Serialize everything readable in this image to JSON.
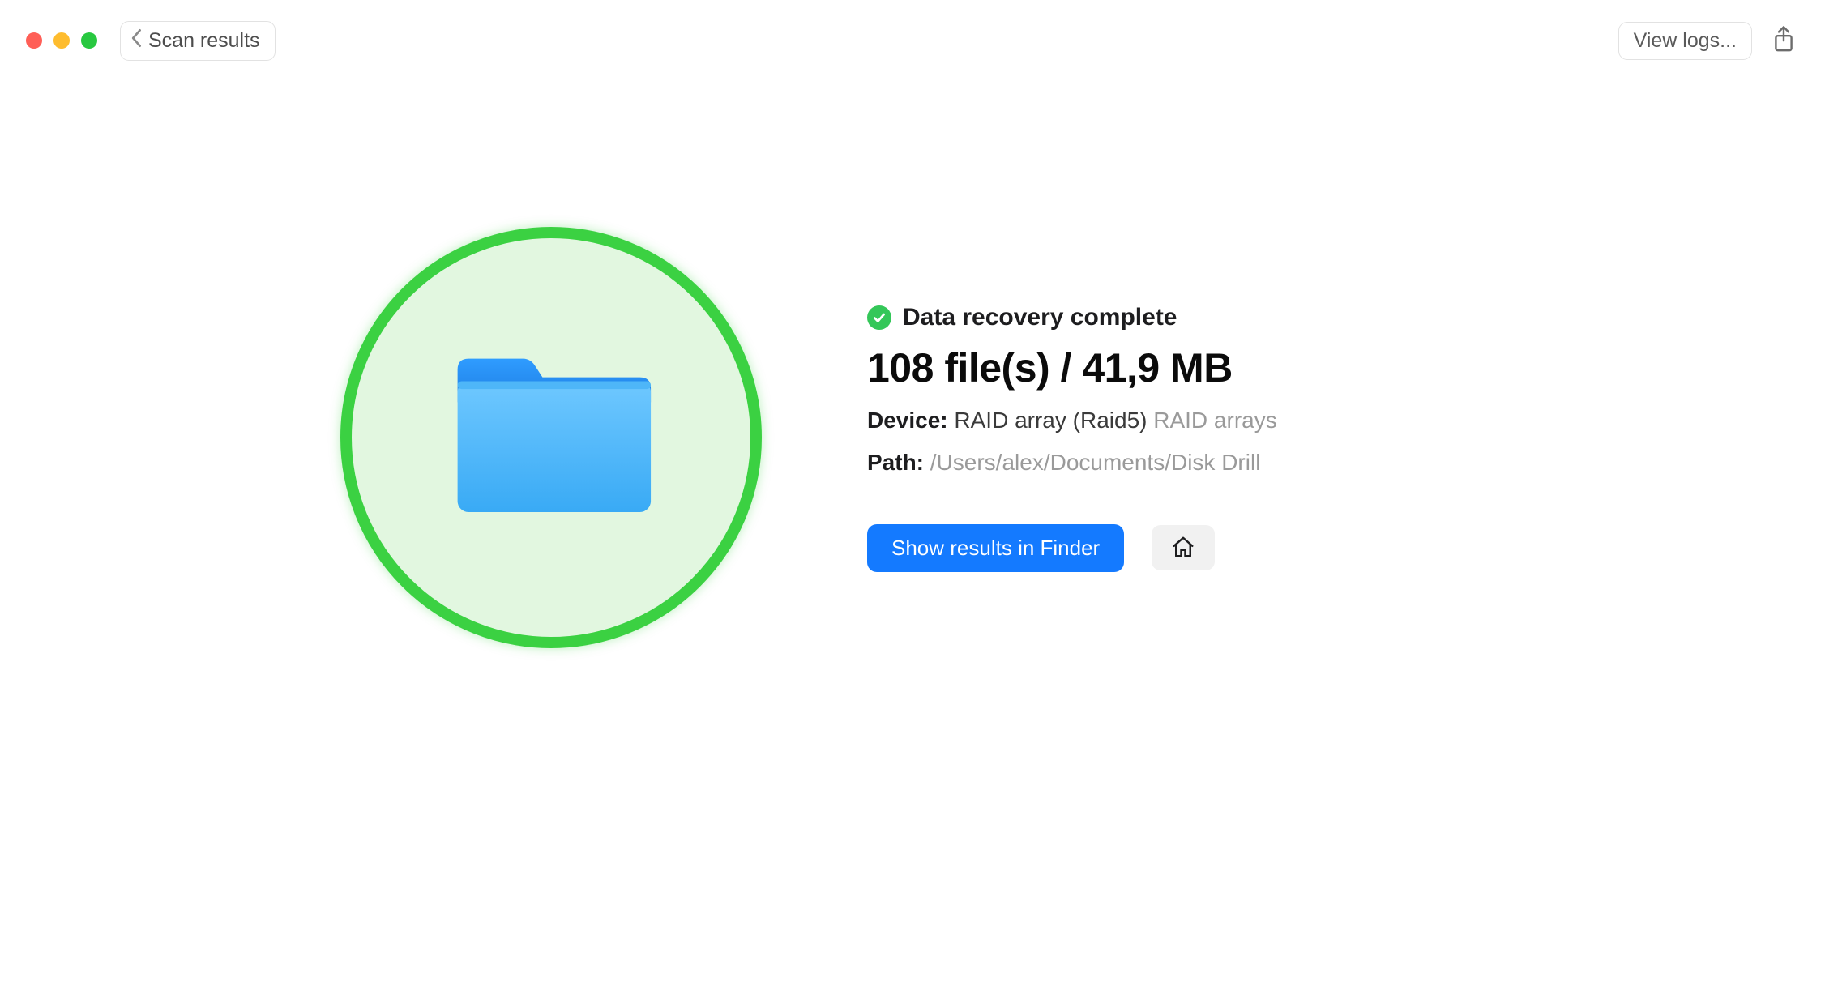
{
  "titlebar": {
    "back_label": "Scan results",
    "view_logs_label": "View logs..."
  },
  "status": {
    "message": "Data recovery complete"
  },
  "summary": {
    "files_count": "108",
    "files_unit": "file(s)",
    "size_value": "41,9",
    "size_unit": "MB",
    "combined": "108 file(s) / 41,9 MB"
  },
  "device": {
    "label": "Device:",
    "name": "RAID array (Raid5)",
    "type": "RAID arrays"
  },
  "path": {
    "label": "Path:",
    "value": "/Users/alex/Documents/Disk Drill"
  },
  "actions": {
    "show_in_finder": "Show results in Finder"
  },
  "colors": {
    "primary": "#147aff",
    "success": "#34c759",
    "ring": "#3bd142"
  }
}
